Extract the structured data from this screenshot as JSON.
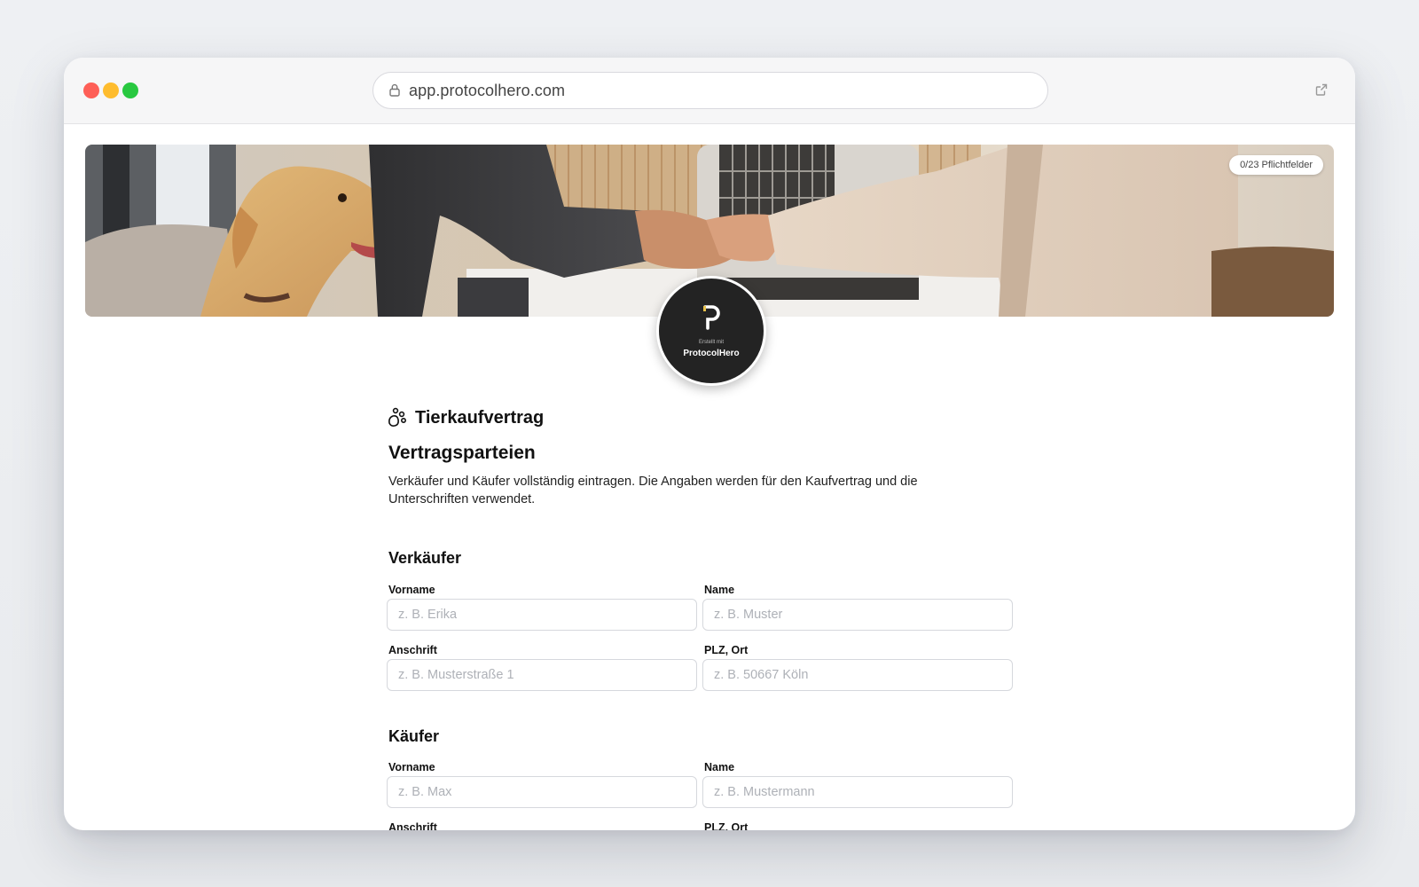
{
  "browser": {
    "url": "app.protocolhero.com",
    "lock_icon": "lock-icon",
    "external_icon": "external-link-icon"
  },
  "hero": {
    "badge": "0/23 Pflichtfelder",
    "image_description_icon": "hero-photo"
  },
  "logo": {
    "subtitle": "Erstellt mit",
    "name": "ProtocolHero"
  },
  "document": {
    "title": "Tierkaufvertrag",
    "icon": "paw-icon"
  },
  "section": {
    "title": "Vertragsparteien",
    "description": "Verkäufer und Käufer vollständig eintragen. Die Angaben werden für den Kaufvertrag und die Unterschriften verwendet."
  },
  "seller": {
    "title": "Verkäufer",
    "firstname_label": "Vorname",
    "firstname_placeholder": "z. B. Erika",
    "firstname_value": "",
    "lastname_label": "Name",
    "lastname_placeholder": "z. B. Muster",
    "lastname_value": "",
    "address_label": "Anschrift",
    "address_placeholder": "z. B. Musterstraße 1",
    "address_value": "",
    "city_label": "PLZ, Ort",
    "city_placeholder": "z. B. 50667 Köln",
    "city_value": ""
  },
  "buyer": {
    "title": "Käufer",
    "firstname_label": "Vorname",
    "firstname_placeholder": "z. B. Max",
    "firstname_value": "",
    "lastname_label": "Name",
    "lastname_placeholder": "z. B. Mustermann",
    "lastname_value": "",
    "address_label": "Anschrift",
    "city_label": "PLZ, Ort"
  }
}
